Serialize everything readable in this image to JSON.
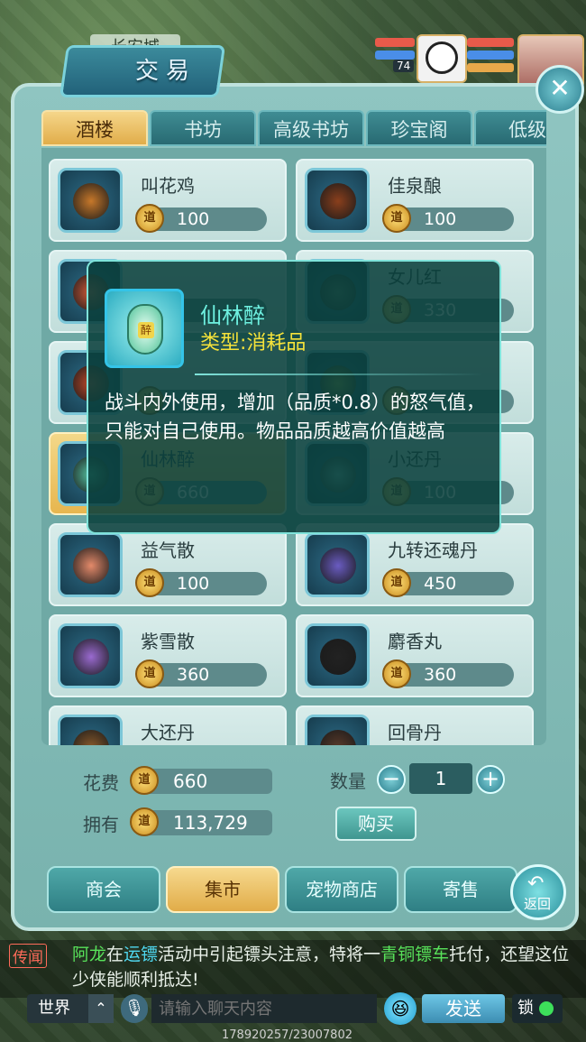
{
  "header": {
    "city_label": "长安城",
    "pet_level": "74",
    "panel_title": "交易"
  },
  "tabs": [
    "酒楼",
    "书坊",
    "高级书坊",
    "珍宝阁",
    "低级"
  ],
  "items": [
    {
      "name": "叫花鸡",
      "price": "100",
      "icon": "roast-chicken-icon",
      "color": "#c7782a"
    },
    {
      "name": "佳泉酿",
      "price": "100",
      "icon": "wine-jar-icon",
      "color": "#8a3f1c"
    },
    {
      "name": "",
      "price": "",
      "icon": "fish-dish-icon",
      "color": "#d35b3a"
    },
    {
      "name": "女儿红",
      "price": "330",
      "icon": "wine-pot-icon",
      "color": "#5a6d59"
    },
    {
      "name": "",
      "price": "",
      "icon": "meat-dish-icon",
      "color": "#c04a2a"
    },
    {
      "name": "",
      "price": "",
      "icon": "food-icon",
      "color": "#9ba13a"
    },
    {
      "name": "仙林醉",
      "price": "660",
      "icon": "jade-bottle-icon",
      "color": "#55c2a2"
    },
    {
      "name": "小还丹",
      "price": "100",
      "icon": "vase-icon",
      "color": "#7ab6b0"
    },
    {
      "name": "益气散",
      "price": "100",
      "icon": "powder-pile-icon",
      "color": "#e48a6a"
    },
    {
      "name": "九转还魂丹",
      "price": "450",
      "icon": "gourd-pills-icon",
      "color": "#6a5cc2"
    },
    {
      "name": "紫雪散",
      "price": "360",
      "icon": "purple-powder-icon",
      "color": "#9a6ad0"
    },
    {
      "name": "麝香丸",
      "price": "360",
      "icon": "black-pills-icon",
      "color": "#222222"
    },
    {
      "name": "大还丹",
      "price": "",
      "icon": "box-icon",
      "color": "#8a5a2a"
    },
    {
      "name": "回骨丹",
      "price": "",
      "icon": "urn-icon",
      "color": "#5a3a2a"
    }
  ],
  "tooltip": {
    "name": "仙林醉",
    "type": "类型:消耗品",
    "description": "战斗内外使用，增加（品质*0.8）的怒气值，只能对自己使用。物品品质越高价值越高"
  },
  "purchase": {
    "cost_label": "花费",
    "cost_value": "660",
    "own_label": "拥有",
    "own_value": "113,729",
    "qty_label": "数量",
    "qty_value": "1",
    "minus": "−",
    "plus": "+",
    "buy_label": "购买"
  },
  "bottom_tabs": [
    "商会",
    "集市",
    "宠物商店",
    "寄售"
  ],
  "back_label": "返回",
  "chat": {
    "tag": "传闻",
    "p1": "阿龙",
    "p2": "在",
    "p3": "运镖",
    "p4": "活动中引起镖头注意，特将一",
    "p5": "青铜镖车",
    "p6": "托付，还望这位少侠能顺利抵达!"
  },
  "chatbar": {
    "channel": "世界",
    "input_placeholder": "请输入聊天内容",
    "send_label": "发送",
    "lock_label": "锁"
  },
  "footer_id": "178920257/23007802",
  "colors": {
    "accent_gold": "#e1ad4a",
    "panel_teal": "#79b3ae",
    "tooltip_bg": "#0a403c"
  }
}
